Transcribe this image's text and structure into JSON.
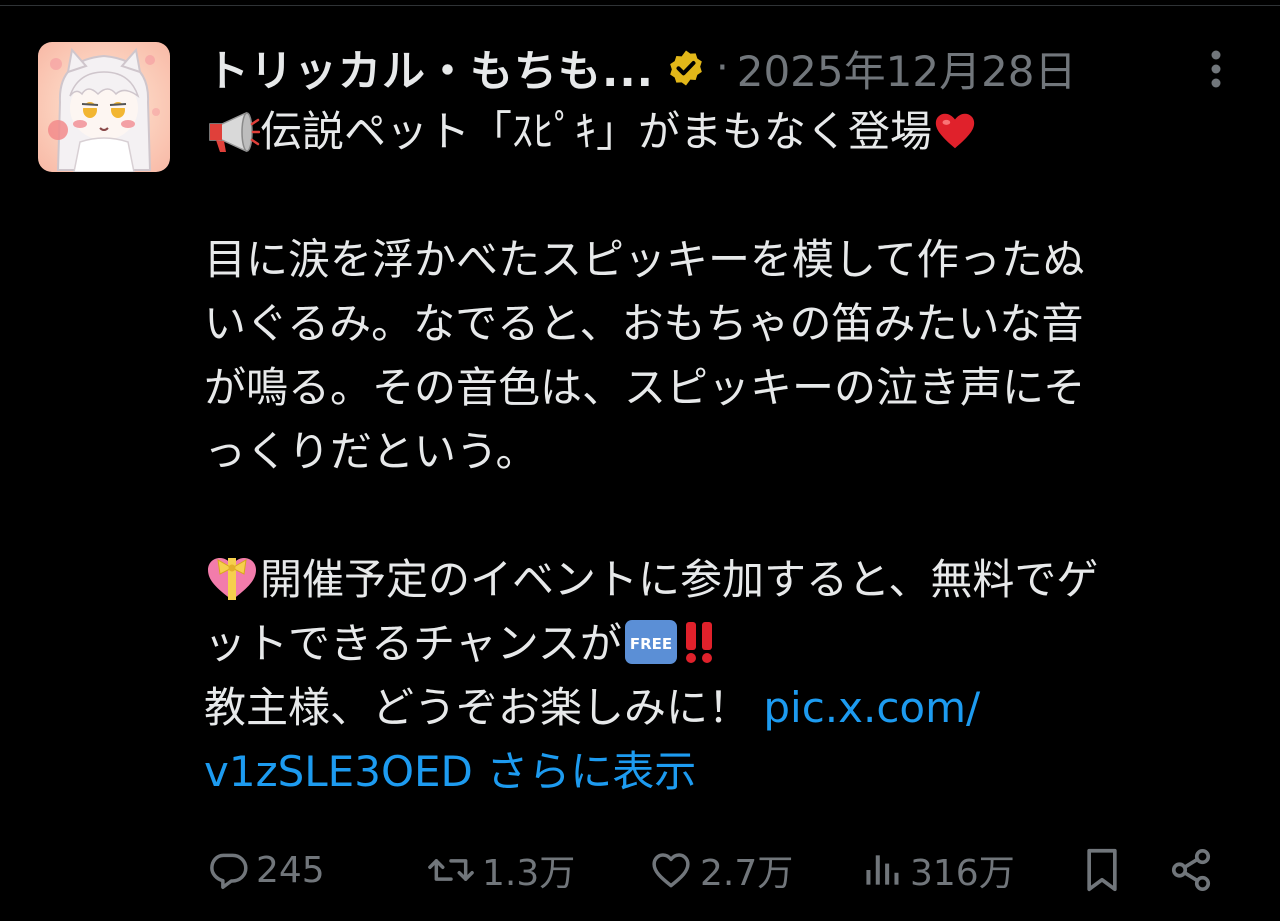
{
  "author": {
    "display_name": "トリッカル・もちも...",
    "separator": "·",
    "timestamp": "2025年12月28日"
  },
  "body": {
    "line1": "伝説ペット「ｽﾋﾟｷ」がまもなく登場",
    "para2": [
      "目に涙を浮かべたスピッキーを模して作ったぬ",
      "いぐるみ。なでると、おもちゃの笛みたいな音",
      "が鳴る。その音色は、スピッキーの泣き声にそ",
      "っくりだという。"
    ],
    "para3_line1": "開催予定のイベントに参加すると、無料でゲ",
    "para3_line2": "ットできるチャンスが",
    "free_badge": "FREE",
    "para3_line3": "教主様、どうぞお楽しみに！ ",
    "link_part1": "pic.x.com/",
    "link_part2": "v1zSLE3OED",
    "show_more": "さらに表示"
  },
  "actions": {
    "replies": "245",
    "reposts": "1.3万",
    "likes": "2.7万",
    "views": "316万"
  },
  "colors": {
    "background": "#000000",
    "text": "#e7e9ea",
    "muted": "#71767b",
    "link": "#1d9bf0",
    "verified_gold": "#e2b719"
  },
  "icons": [
    "avatar-illustration",
    "verified-badge-icon",
    "more-icon",
    "megaphone-icon",
    "red-heart-icon",
    "heart-ribbon-icon",
    "free-badge-icon",
    "double-exclamation-icon",
    "reply-icon",
    "repost-icon",
    "like-icon",
    "views-icon",
    "bookmark-icon",
    "share-icon"
  ]
}
